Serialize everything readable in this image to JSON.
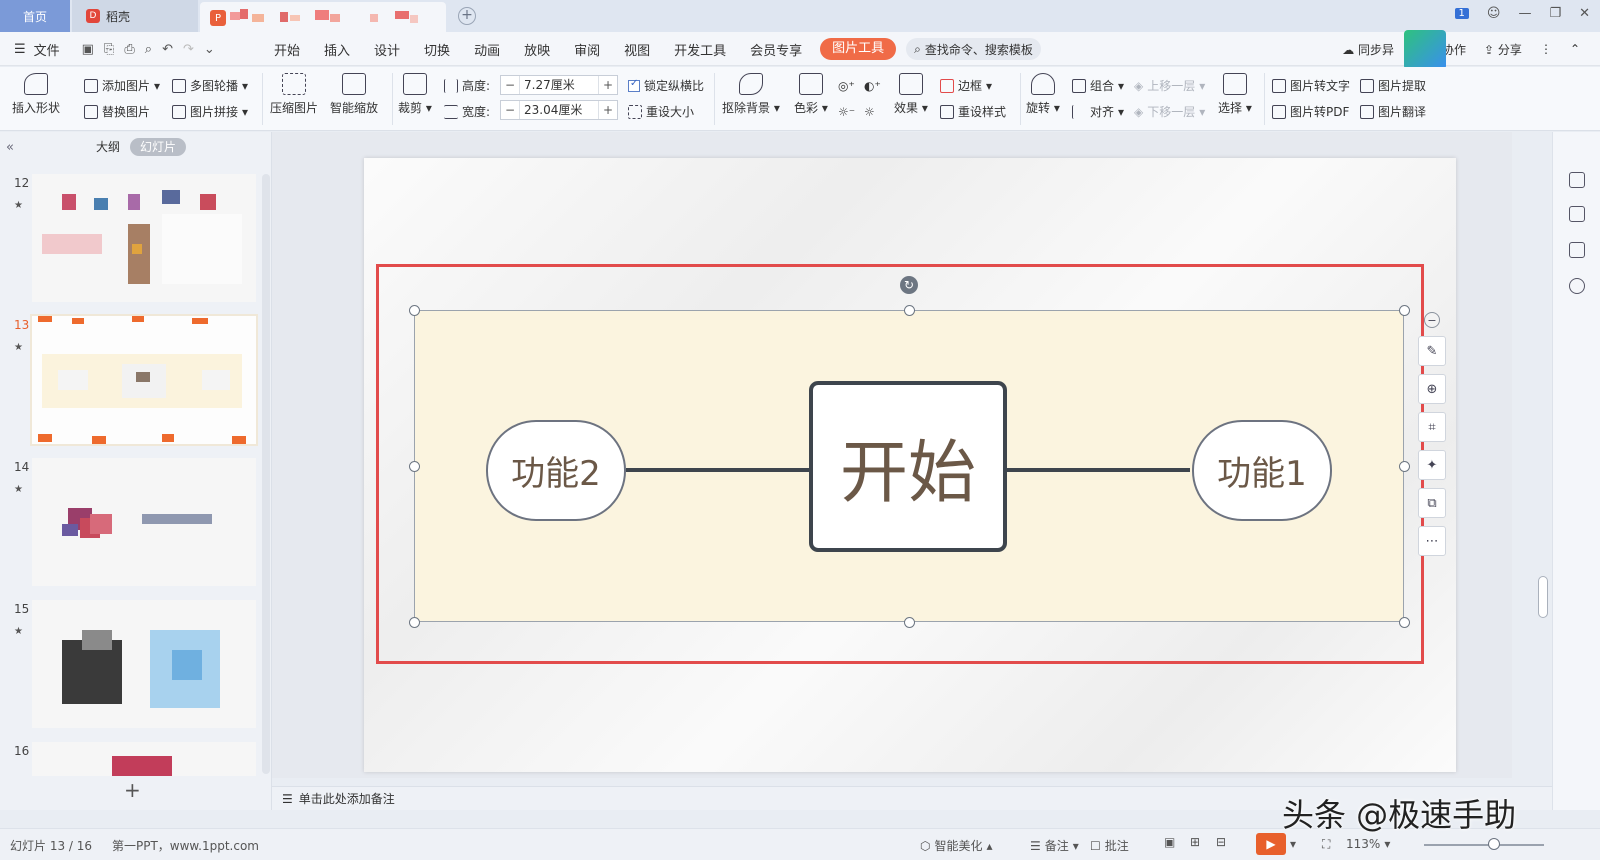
{
  "titlebar": {
    "home_tab": "首页",
    "daoke_tab": "稻壳",
    "win_badge": "1"
  },
  "menubar": {
    "file": "文件",
    "tabs": [
      "开始",
      "插入",
      "设计",
      "切换",
      "动画",
      "放映",
      "审阅",
      "视图",
      "开发工具",
      "会员专享"
    ],
    "active_tab": "图片工具",
    "search": "查找命令、搜索模板",
    "sync": "同步异",
    "collab": "协作",
    "share": "分享"
  },
  "ribbon": {
    "insert_shape": "插入形状",
    "add_picture": "添加图片",
    "replace_picture": "替换图片",
    "multi_carousel": "多图轮播",
    "picture_stitch": "图片拼接",
    "compress": "压缩图片",
    "smart_zoom": "智能缩放",
    "crop": "裁剪",
    "height_label": "高度:",
    "height_value": "7.27厘米",
    "width_label": "宽度:",
    "width_value": "23.04厘米",
    "lock_ratio": "锁定纵横比",
    "reset_size": "重设大小",
    "remove_bg": "抠除背景",
    "color": "色彩",
    "effect": "效果",
    "border": "边框",
    "reset_style": "重设样式",
    "rotate": "旋转",
    "group": "组合",
    "align": "对齐",
    "bring_forward": "上移一层",
    "send_backward": "下移一层",
    "select": "选择",
    "pic_to_text": "图片转文字",
    "pic_to_pdf": "图片转PDF",
    "pic_extract": "图片提取",
    "pic_translate": "图片翻译"
  },
  "leftpanel": {
    "outline_tab": "大纲",
    "slides_tab": "幻灯片",
    "slide_numbers": [
      "12",
      "13",
      "14",
      "15",
      "16"
    ],
    "selected_slide": "13"
  },
  "slide": {
    "center_node": "开始",
    "left_node": "功能2",
    "right_node": "功能1"
  },
  "notes": {
    "placeholder": "单击此处添加备注"
  },
  "statusbar": {
    "slide_info": "幻灯片 13 / 16",
    "template": "第一PPT，www.1ppt.com",
    "smart_beautify": "智能美化",
    "notes": "备注",
    "comments": "批注",
    "zoom": "113%"
  },
  "watermark": "头条 @极速手助",
  "colors": {
    "accent": "#f06b47",
    "selection_red": "#e24b4b",
    "picture_bg": "#fbf4df"
  }
}
